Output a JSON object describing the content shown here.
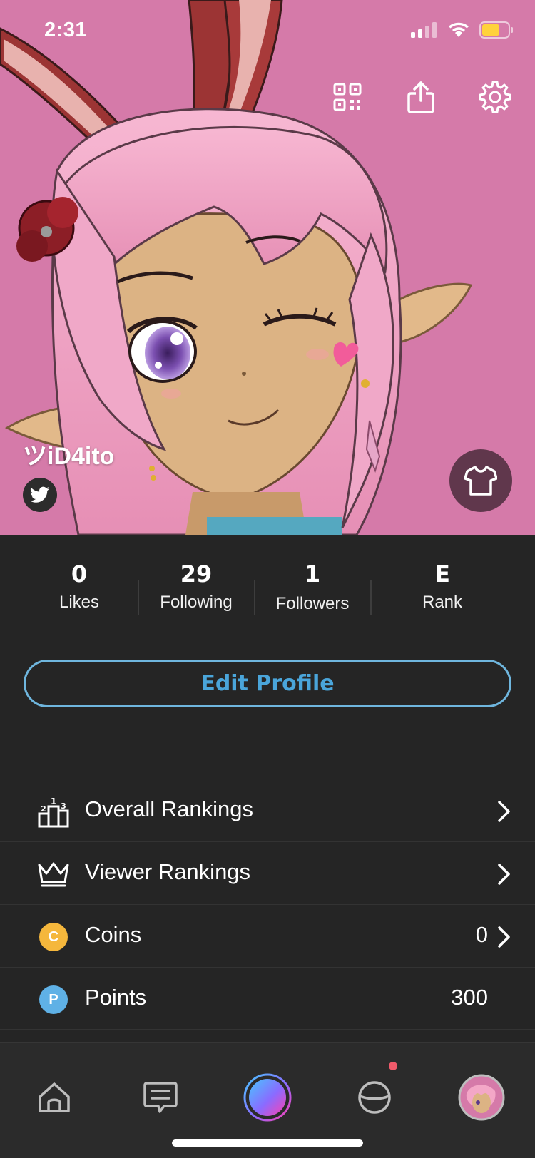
{
  "status_bar": {
    "time": "2:31"
  },
  "profile": {
    "display_name": "ツiD4ito"
  },
  "stats": [
    {
      "value": "0",
      "label": "Likes"
    },
    {
      "value": "29",
      "label": "Following"
    },
    {
      "value": "1",
      "label": "Followers"
    },
    {
      "value": "E",
      "label": "Rank"
    }
  ],
  "edit_profile_label": "Edit Profile",
  "menu": {
    "overall_rankings": {
      "label": "Overall Rankings"
    },
    "viewer_rankings": {
      "label": "Viewer Rankings"
    },
    "coins": {
      "label": "Coins",
      "value": "0",
      "badge": "C"
    },
    "points": {
      "label": "Points",
      "value": "300",
      "badge": "P"
    }
  },
  "tabs": [
    {
      "icon": "home-icon"
    },
    {
      "icon": "chat-icon"
    },
    {
      "icon": "live-orb-icon"
    },
    {
      "icon": "explore-planet-icon"
    },
    {
      "icon": "profile-avatar-icon"
    }
  ],
  "colors": {
    "hero_background": "#d57aa9",
    "accent_blue": "#4aa5da",
    "coin_yellow": "#f5b73c",
    "points_blue": "#5fb1e6",
    "notification_red": "#f05a6a",
    "battery_yellow": "#ffd23c"
  }
}
